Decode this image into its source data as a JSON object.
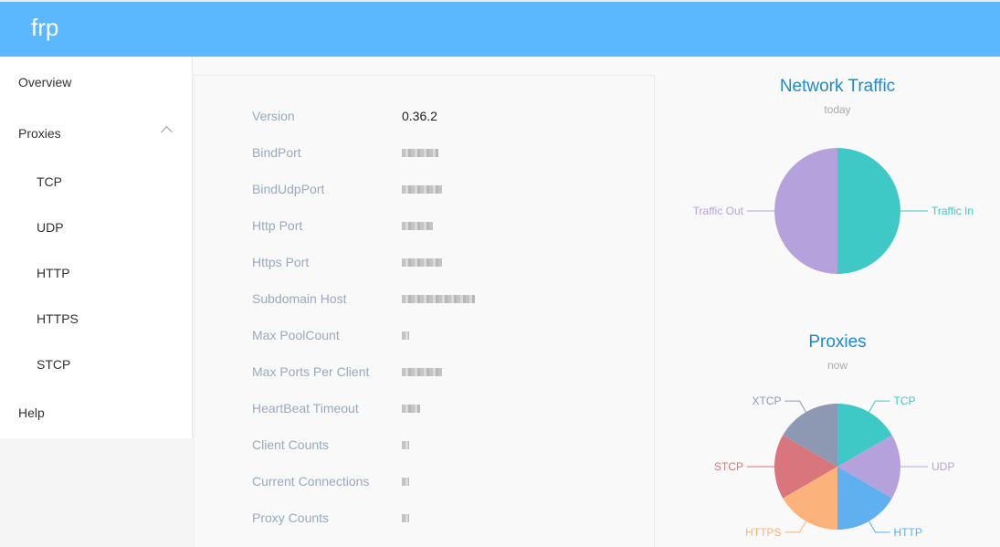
{
  "app": {
    "title": "frp"
  },
  "sidebar": {
    "overview": "Overview",
    "proxies": "Proxies",
    "proxy_types": [
      "TCP",
      "UDP",
      "HTTP",
      "HTTPS",
      "STCP"
    ],
    "help": "Help"
  },
  "server_info": {
    "rows": [
      {
        "label": "Version",
        "value": "0.36.2"
      },
      {
        "label": "BindPort",
        "value": ""
      },
      {
        "label": "BindUdpPort",
        "value": ""
      },
      {
        "label": "Http Port",
        "value": ""
      },
      {
        "label": "Https Port",
        "value": ""
      },
      {
        "label": "Subdomain Host",
        "value": ""
      },
      {
        "label": "Max PoolCount",
        "value": ""
      },
      {
        "label": "Max Ports Per Client",
        "value": ""
      },
      {
        "label": "HeartBeat Timeout",
        "value": ""
      },
      {
        "label": "Client Counts",
        "value": ""
      },
      {
        "label": "Current Connections",
        "value": ""
      },
      {
        "label": "Proxy Counts",
        "value": ""
      }
    ]
  },
  "chart_data": [
    {
      "type": "pie",
      "title": "Network Traffic",
      "subtitle": "today",
      "labels": [
        "Traffic In",
        "Traffic Out"
      ],
      "values": [
        50,
        50
      ],
      "colors": [
        "#3ec9c6",
        "#b5a2dd"
      ]
    },
    {
      "type": "pie",
      "title": "Proxies",
      "subtitle": "now",
      "labels": [
        "TCP",
        "UDP",
        "HTTP",
        "HTTPS",
        "STCP",
        "XTCP"
      ],
      "values": [
        1,
        1,
        1,
        1,
        1,
        1
      ],
      "colors": [
        "#3ec9c6",
        "#b5a2dd",
        "#5eb0ee",
        "#fcb37b",
        "#d9757c",
        "#8d98b3"
      ]
    }
  ]
}
